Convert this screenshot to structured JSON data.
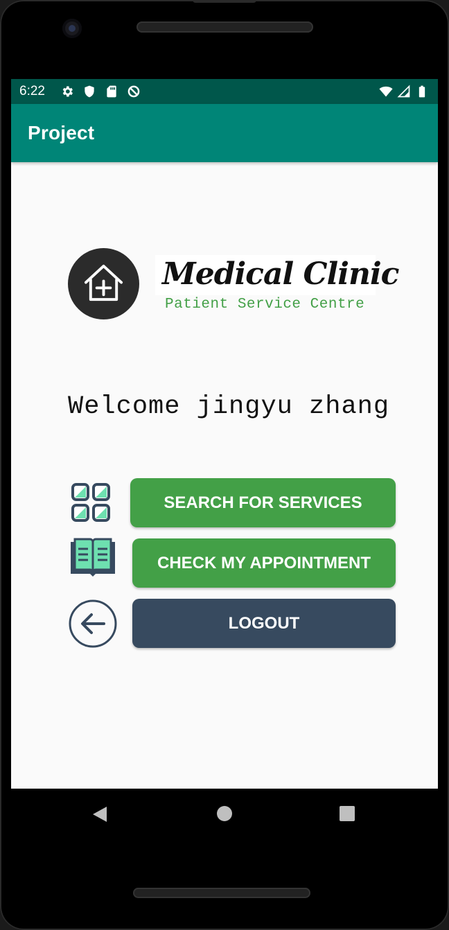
{
  "status_bar": {
    "time": "6:22",
    "left_icons": [
      "gear-icon",
      "shield-icon",
      "sd-card-icon",
      "no-disturb-icon"
    ],
    "right_icons": [
      "wifi-icon",
      "signal-icon",
      "battery-icon"
    ]
  },
  "app_bar": {
    "title": "Project"
  },
  "logo": {
    "title": "Medical Clinic",
    "subtitle": "Patient Service Centre",
    "icon": "clinic-house-plus-icon"
  },
  "welcome_text": "Welcome jingyu zhang",
  "actions": {
    "search": {
      "label": "SEARCH FOR SERVICES",
      "icon": "grid-icon"
    },
    "appointment": {
      "label": "CHECK MY APPOINTMENT",
      "icon": "book-icon"
    },
    "logout": {
      "label": "LOGOUT",
      "icon": "back-arrow-circle-icon"
    }
  },
  "colors": {
    "status_bar": "#00574b",
    "app_bar": "#008577",
    "green_button": "#43a047",
    "dark_button": "#374a5f"
  },
  "nav_bar": {
    "icons": [
      "back-triangle-icon",
      "home-circle-icon",
      "recents-square-icon"
    ]
  }
}
